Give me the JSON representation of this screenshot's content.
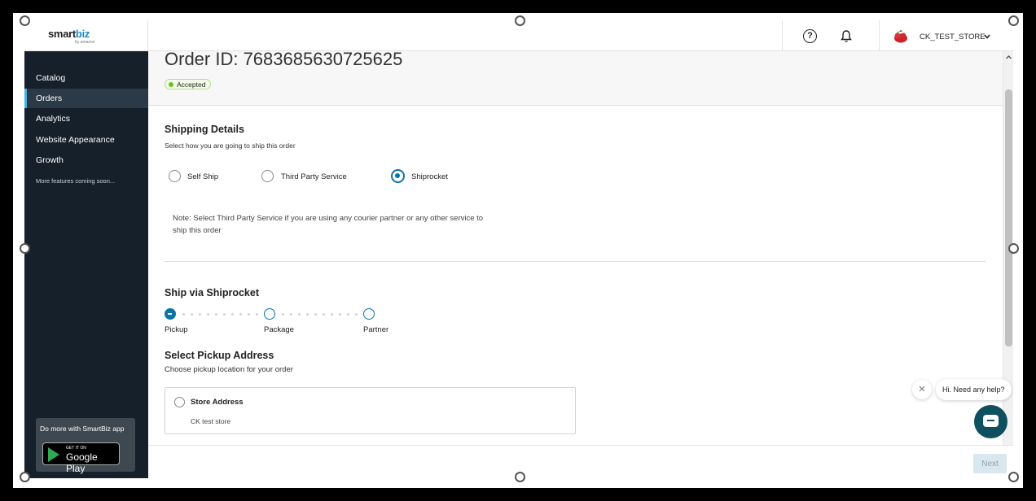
{
  "header": {
    "logo_main": "smart",
    "logo_accent": "biz",
    "logo_sub": "by amazon",
    "help_icon": "?",
    "store_name": "CK_TEST_STORE"
  },
  "sidebar": {
    "items": [
      {
        "label": "Catalog"
      },
      {
        "label": "Orders"
      },
      {
        "label": "Analytics"
      },
      {
        "label": "Website Appearance"
      },
      {
        "label": "Growth"
      }
    ],
    "coming_soon": "More features coming soon...",
    "promo_text": "Do more with SmartBiz app",
    "gplay_small": "GET IT ON",
    "gplay_big": "Google Play"
  },
  "order": {
    "title": "Order ID: 7683685630725625",
    "status": "Accepted",
    "status_color": "#6bbf2a"
  },
  "shipping": {
    "title": "Shipping Details",
    "subtitle": "Select how you are going to ship this order",
    "options": [
      {
        "label": "Self Ship",
        "selected": false
      },
      {
        "label": "Third Party Service",
        "selected": false
      },
      {
        "label": "Shiprocket",
        "selected": true
      }
    ],
    "note": "Note: Select Third Party Service if you are using any courier partner or any other service to ship this order"
  },
  "shiprocket": {
    "title": "Ship via Shiprocket",
    "steps": [
      {
        "label": "Pickup",
        "state": "current"
      },
      {
        "label": "Package",
        "state": "pending"
      },
      {
        "label": "Partner",
        "state": "pending"
      }
    ]
  },
  "pickup": {
    "title": "Select Pickup Address",
    "subtitle": "Choose pickup location for your order",
    "address_title": "Store Address",
    "address_sub": "CK test store"
  },
  "chat": {
    "close": "✕",
    "bubble": "Hi. Need any help?"
  },
  "footer": {
    "next_label": "Next"
  },
  "colors": {
    "accent": "#0b74a8",
    "sidebar_bg": "#16202b",
    "chat_bg": "#0f5060"
  }
}
